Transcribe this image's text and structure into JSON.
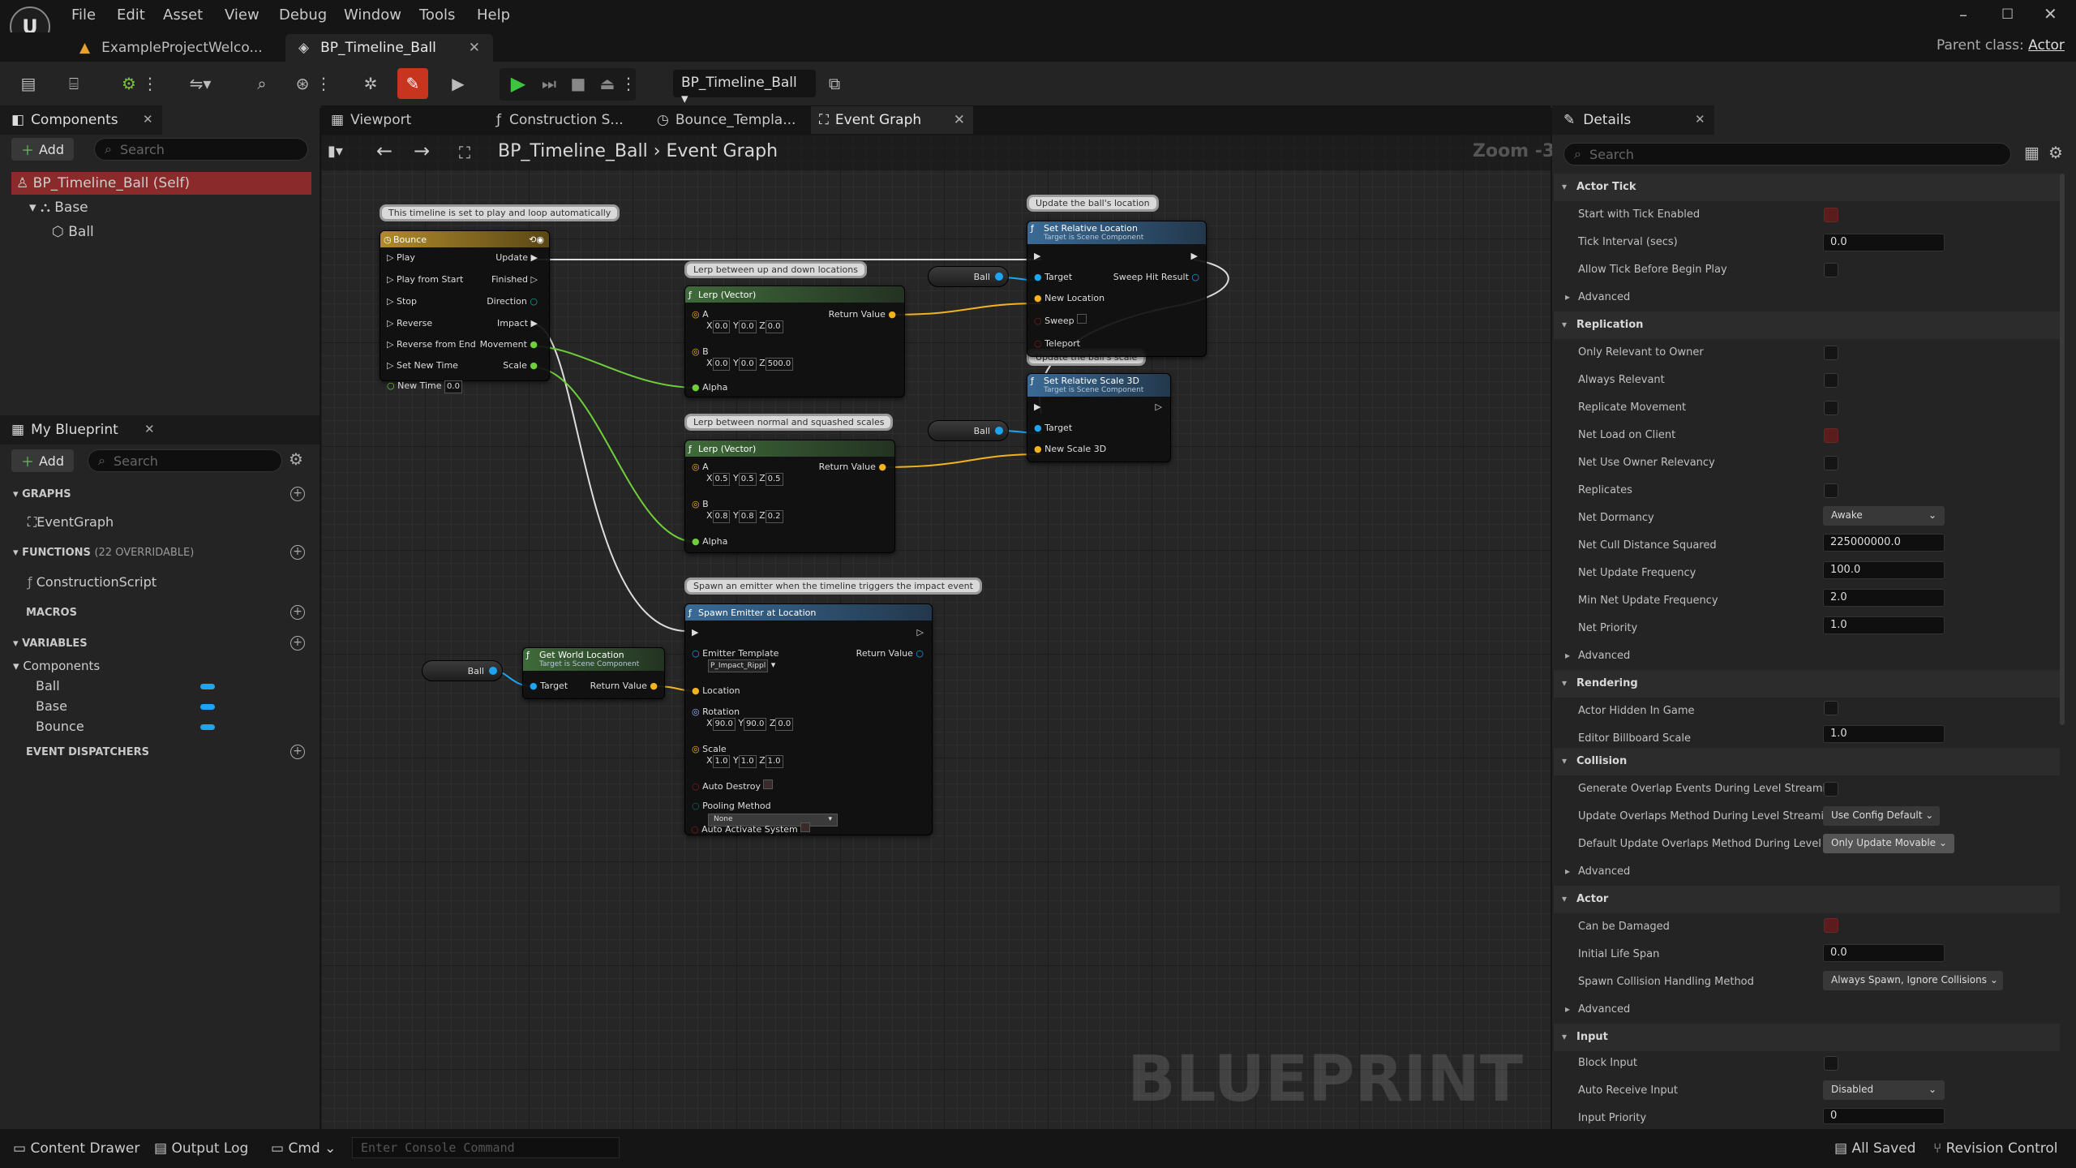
{
  "menu": {
    "items": [
      "File",
      "Edit",
      "Asset",
      "View",
      "Debug",
      "Window",
      "Tools",
      "Help"
    ]
  },
  "tabs": {
    "first": "ExampleProjectWelco...",
    "second": "BP_Timeline_Ball"
  },
  "parent_class": {
    "label": "Parent class:",
    "value": "Actor"
  },
  "toolbar": {
    "debug_object": "BP_Timeline_Ball"
  },
  "components": {
    "tab": "Components",
    "add": "Add",
    "search_placeholder": "Search",
    "self": "BP_Timeline_Ball (Self)",
    "base": "Base",
    "ball": "Ball"
  },
  "myblueprint": {
    "tab": "My Blueprint",
    "add": "Add",
    "search_placeholder": "Search",
    "graphs": "GRAPHS",
    "event_graph": "EventGraph",
    "functions": "FUNCTIONS",
    "functions_sub": "(22 OVERRIDABLE)",
    "construction_script": "ConstructionScript",
    "macros": "MACROS",
    "variables": "VARIABLES",
    "components_cat": "Components",
    "vars": [
      "Ball",
      "Base",
      "Bounce"
    ],
    "event_dispatchers": "EVENT DISPATCHERS"
  },
  "graph_tabs": [
    "Viewport",
    "Construction S...",
    "Bounce_Templa...",
    "Event Graph"
  ],
  "breadcrumb": {
    "bp": "BP_Timeline_Ball",
    "graph": "Event Graph",
    "zoom": "Zoom -3"
  },
  "watermark": "BLUEPRINT",
  "nodes": {
    "comment_timeline": "This timeline is set to play and loop automatically",
    "comment_update_loc": "Update the ball's location",
    "comment_lerp_loc": "Lerp between up and down locations",
    "comment_update_scale": "Update the ball's scale",
    "comment_lerp_scale": "Lerp between normal and squashed scales",
    "comment_spawn": "Spawn an emitter when the timeline triggers the impact event",
    "bounce": {
      "title": "Bounce",
      "inputs": [
        "Play",
        "Play from Start",
        "Stop",
        "Reverse",
        "Reverse from End",
        "Set New Time",
        "New Time"
      ],
      "outputs": [
        "Update",
        "Finished",
        "Direction",
        "Impact",
        "Movement",
        "Scale"
      ],
      "new_time": "0.0"
    },
    "lerp_loc": {
      "title": "Lerp (Vector)",
      "a": [
        "0.0",
        "0.0",
        "0.0"
      ],
      "b": [
        "0.0",
        "0.0",
        "500.0"
      ],
      "alpha": "Alpha",
      "ret": "Return Value",
      "a_label": "A",
      "b_label": "B"
    },
    "lerp_scale": {
      "title": "Lerp (Vector)",
      "a": [
        "0.5",
        "0.5",
        "0.5"
      ],
      "b": [
        "0.8",
        "0.8",
        "0.2"
      ],
      "alpha": "Alpha",
      "ret": "Return Value",
      "a_label": "A",
      "b_label": "B"
    },
    "set_loc": {
      "title": "Set Relative Location",
      "sub": "Target is Scene Component",
      "target": "Target",
      "new_location": "New Location",
      "sweep": "Sweep",
      "teleport": "Teleport",
      "sweep_hit": "Sweep Hit Result"
    },
    "set_scale": {
      "title": "Set Relative Scale 3D",
      "sub": "Target is Scene Component",
      "target": "Target",
      "new_scale": "New Scale 3D"
    },
    "spawn": {
      "title": "Spawn Emitter at Location",
      "emitter_template": "Emitter Template",
      "template_value": "P_Impact_Rippl",
      "location": "Location",
      "rotation": "Rotation",
      "rot": [
        "90.0",
        "90.0",
        "0.0"
      ],
      "scale": "Scale",
      "scl": [
        "1.0",
        "1.0",
        "1.0"
      ],
      "auto_destroy": "Auto Destroy",
      "pooling": "Pooling Method",
      "pooling_value": "None",
      "auto_activate": "Auto Activate System",
      "ret": "Return Value"
    },
    "get_world": {
      "title": "Get World Location",
      "sub": "Target is Scene Component",
      "target": "Target",
      "ret": "Return Value"
    },
    "ball_var": "Ball",
    "axis": [
      "X",
      "Y",
      "Z"
    ]
  },
  "details": {
    "tab": "Details",
    "search_placeholder": "Search",
    "actor_tick": "Actor Tick",
    "start_tick": "Start with Tick Enabled",
    "tick_interval": "Tick Interval (secs)",
    "tick_interval_val": "0.0",
    "allow_tick": "Allow Tick Before Begin Play",
    "advanced": "Advanced",
    "replication": "Replication",
    "only_relevant": "Only Relevant to Owner",
    "always_relevant": "Always Relevant",
    "replicate_movement": "Replicate Movement",
    "net_load": "Net Load on Client",
    "net_use_owner": "Net Use Owner Relevancy",
    "replicates": "Replicates",
    "net_dormancy": "Net Dormancy",
    "net_dormancy_val": "Awake",
    "net_cull": "Net Cull Distance Squared",
    "net_cull_val": "225000000.0",
    "net_update": "Net Update Frequency",
    "net_update_val": "100.0",
    "min_net_update": "Min Net Update Frequency",
    "min_net_update_val": "2.0",
    "net_priority": "Net Priority",
    "net_priority_val": "1.0",
    "rendering": "Rendering",
    "hidden_in_game": "Actor Hidden In Game",
    "billboard_scale": "Editor Billboard Scale",
    "billboard_scale_val": "1.0",
    "collision": "Collision",
    "gen_overlap": "Generate Overlap Events During Level Streaming",
    "update_overlaps": "Update Overlaps Method During Level Streaming",
    "update_overlaps_val": "Use Config Default",
    "default_update_overlaps": "Default Update Overlaps Method During Level S...",
    "default_update_overlaps_val": "Only Update Movable",
    "actor": "Actor",
    "can_be_damaged": "Can be Damaged",
    "initial_life": "Initial Life Span",
    "initial_life_val": "0.0",
    "spawn_collision": "Spawn Collision Handling Method",
    "spawn_collision_val": "Always Spawn, Ignore Collisions",
    "input": "Input",
    "block_input": "Block Input",
    "auto_receive": "Auto Receive Input",
    "auto_receive_val": "Disabled",
    "input_priority": "Input Priority",
    "input_priority_val": "0"
  },
  "status": {
    "content_drawer": "Content Drawer",
    "output_log": "Output Log",
    "cmd": "Cmd",
    "console_placeholder": "Enter Console Command",
    "all_saved": "All Saved",
    "revision_control": "Revision Control"
  }
}
